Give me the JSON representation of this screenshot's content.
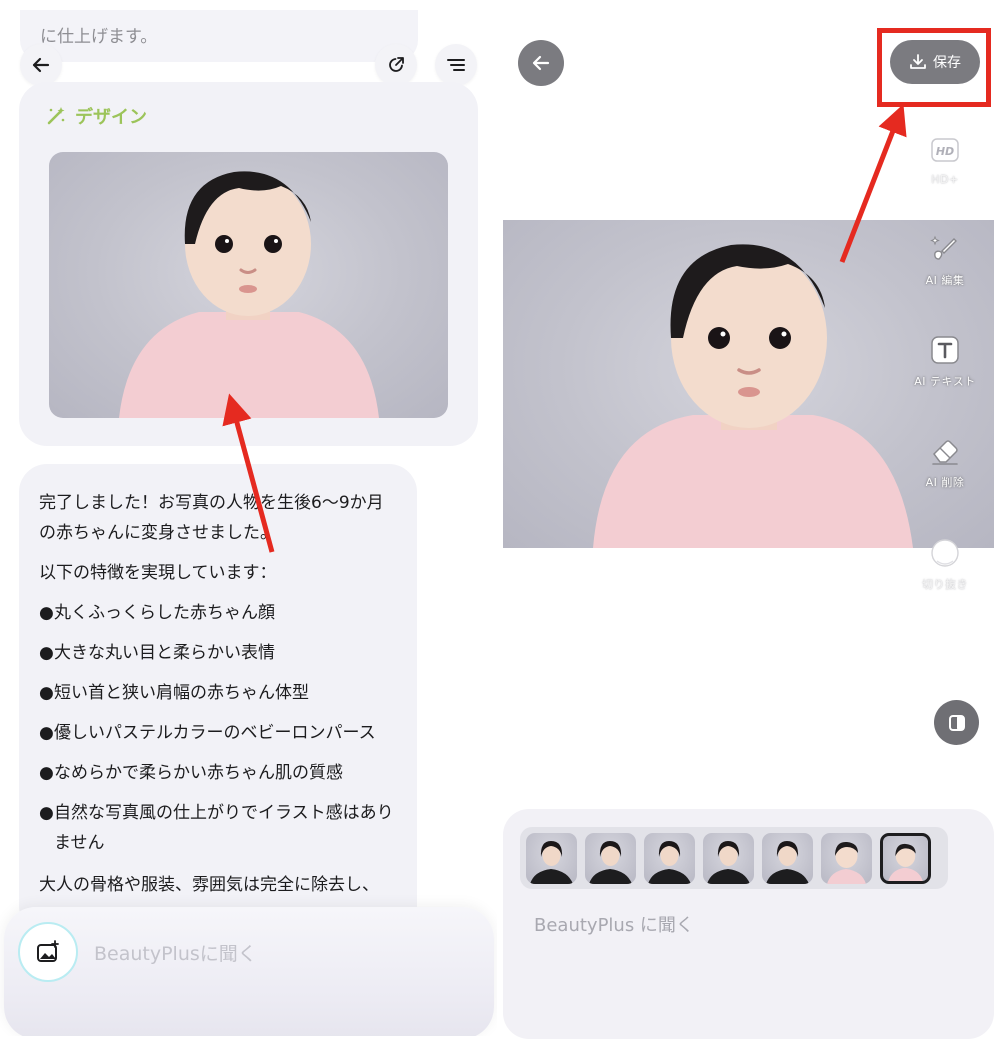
{
  "left": {
    "top_snippet_text": "に仕上げます。",
    "design": {
      "title": "デザイン",
      "photo_alt": "baby portrait"
    },
    "message": {
      "intro": "完了しました！お写真の人物を生後6〜9か月の赤ちゃんに変身させました。",
      "features_heading": "以下の特徴を実現しています：",
      "bullets": [
        "丸くふっくらした赤ちゃん顔",
        "大きな丸い目と柔らかい表情",
        "短い首と狭い肩幅の赤ちゃん体型",
        "優しいパステルカラーのベビーロンパース",
        "なめらかで柔らかい赤ちゃん肌の質感",
        "自然な写真風の仕上がりでイラスト感はありません"
      ],
      "closing": "大人の骨格や服装、雰囲気は完全に除去し、"
    },
    "input_placeholder": "BeautyPlusに聞く",
    "icons": {
      "back": "arrow-left-icon",
      "share": "external-share-icon",
      "menu": "list-menu-icon",
      "design": "magic-wand-icon",
      "attach": "image-add-icon"
    }
  },
  "right": {
    "save_label": "保存",
    "tools": [
      {
        "icon": "hd-icon",
        "label": "HD+"
      },
      {
        "icon": "ai-edit-brush-icon",
        "label": "AI 編集"
      },
      {
        "icon": "text-icon",
        "label": "AI テキスト"
      },
      {
        "icon": "eraser-icon",
        "label": "AI 削除"
      },
      {
        "icon": "cutout-icon",
        "label": "切り抜き"
      }
    ],
    "thumbnails_count_note": "7",
    "input_placeholder": "BeautyPlus に聞く"
  },
  "colors": {
    "accent_green": "#9cc45a",
    "highlight_red": "#e52a20",
    "card_bg": "#f2f2f7",
    "dark_button": "#7b7b80"
  }
}
